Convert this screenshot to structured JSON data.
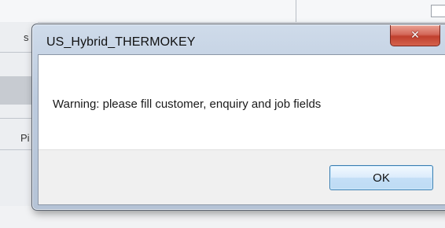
{
  "background": {
    "left_labels": [
      "s",
      "Pi"
    ]
  },
  "dialog": {
    "title": "US_Hybrid_THERMOKEY",
    "close_icon": "close-icon",
    "close_glyph": "✕",
    "message": "Warning: please fill customer, enquiry and job fields",
    "ok_label": "OK"
  },
  "colors": {
    "close_button": "#c9503d",
    "ok_button_border": "#3c7fb1",
    "frame": "#bccbde"
  }
}
